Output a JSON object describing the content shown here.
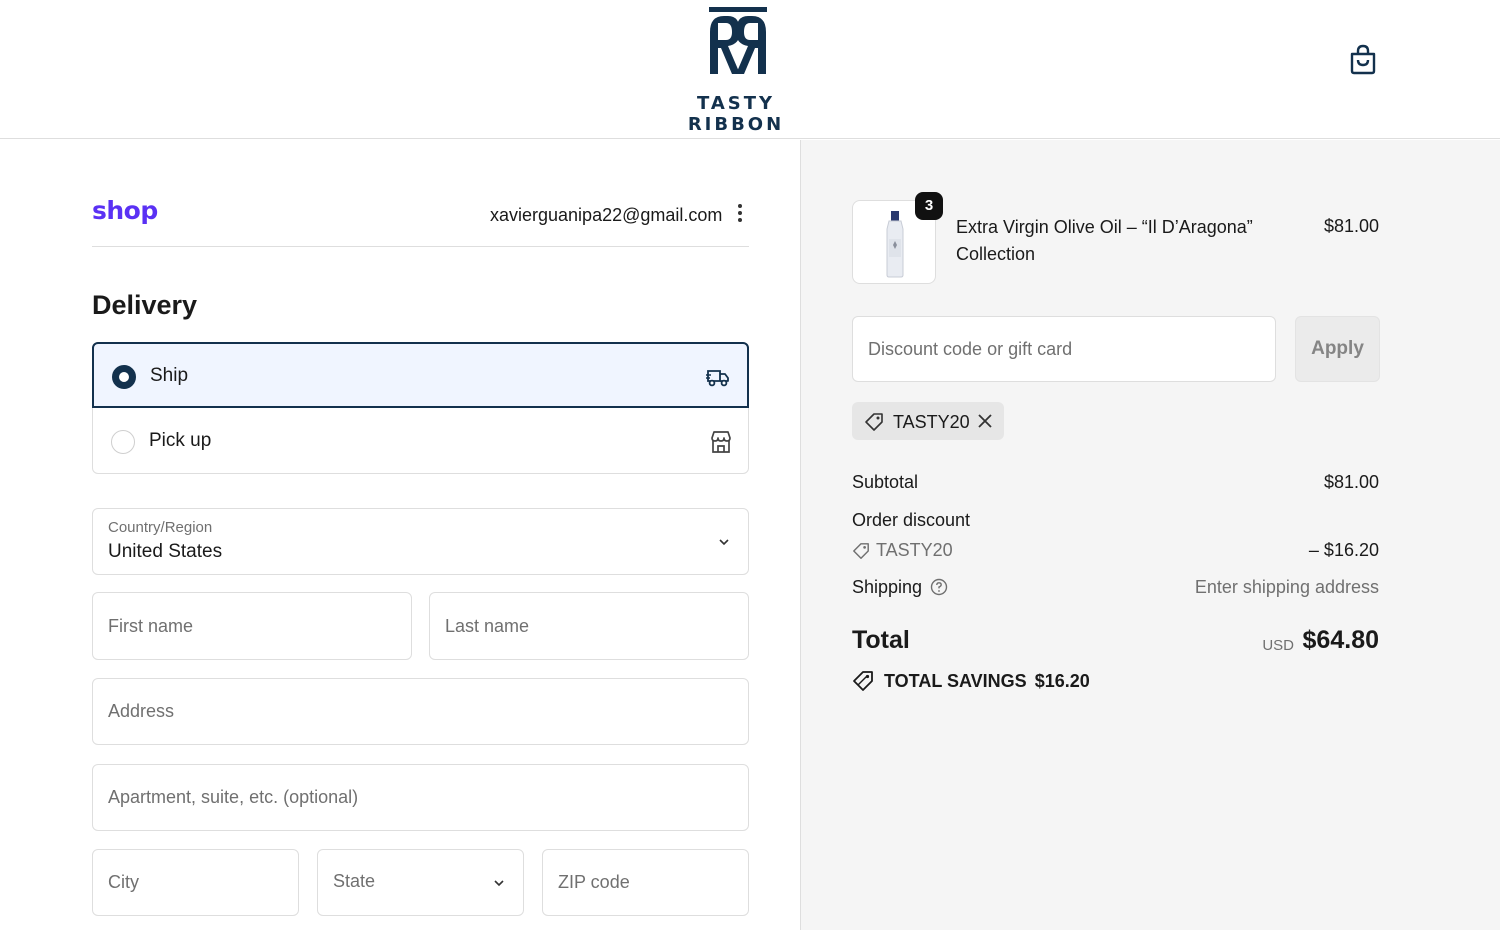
{
  "brand": {
    "name": "TASTY RIBBON"
  },
  "account": {
    "provider": "shop",
    "email": "xavierguanipa22@gmail.com"
  },
  "delivery": {
    "title": "Delivery",
    "methods": [
      {
        "label": "Ship",
        "selected": true
      },
      {
        "label": "Pick up",
        "selected": false
      }
    ]
  },
  "form": {
    "country_label": "Country/Region",
    "country_value": "United States",
    "first_name_placeholder": "First name",
    "last_name_placeholder": "Last name",
    "address_placeholder": "Address",
    "apartment_placeholder": "Apartment, suite, etc. (optional)",
    "city_placeholder": "City",
    "state_placeholder": "State",
    "zip_placeholder": "ZIP code"
  },
  "order": {
    "item": {
      "name": "Extra Virgin Olive Oil – “Il D’Aragona” Collection",
      "quantity": "3",
      "price": "$81.00"
    },
    "discount_placeholder": "Discount code or gift card",
    "apply_label": "Apply",
    "applied_code": "TASTY20",
    "subtotal_label": "Subtotal",
    "subtotal_value": "$81.00",
    "discount_label": "Order discount",
    "discount_code": "TASTY20",
    "discount_value": "– $16.20",
    "shipping_label": "Shipping",
    "shipping_value": "Enter shipping address",
    "total_label": "Total",
    "currency": "USD",
    "total_value": "$64.80",
    "savings_label": "TOTAL SAVINGS",
    "savings_value": "$16.20"
  },
  "colors": {
    "brand_navy": "#13314d",
    "shop_purple": "#5a31f4",
    "selected_bg": "#f0f5ff"
  }
}
